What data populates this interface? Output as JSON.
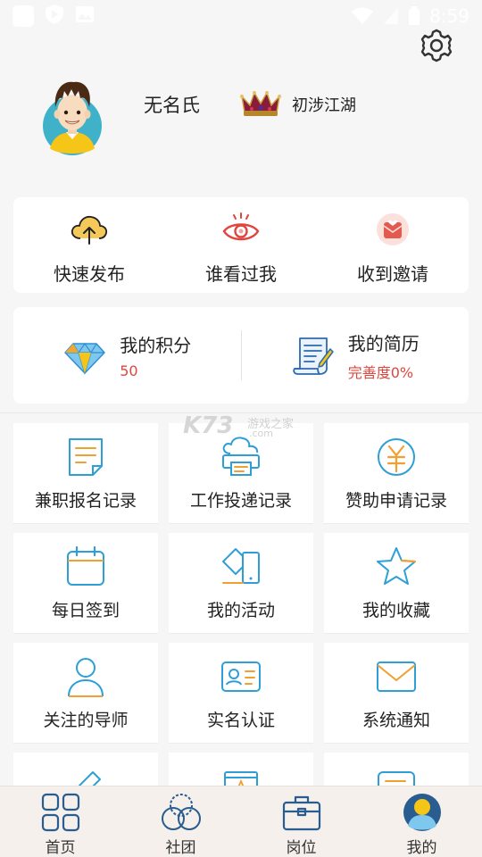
{
  "status_bar": {
    "time": "8:59"
  },
  "profile": {
    "name": "无名氏",
    "rank": "初涉江湖"
  },
  "actions": [
    {
      "label": "快速发布",
      "icon": "cloud-upload-icon"
    },
    {
      "label": "谁看过我",
      "icon": "eye-icon"
    },
    {
      "label": "收到邀请",
      "icon": "invitation-icon"
    }
  ],
  "stats": {
    "points": {
      "title": "我的积分",
      "value": "50",
      "icon": "diamond-icon"
    },
    "resume": {
      "title": "我的简历",
      "value": "完善度0%",
      "icon": "resume-icon"
    }
  },
  "grid": [
    {
      "label": "兼职报名记录",
      "icon": "document-icon"
    },
    {
      "label": "工作投递记录",
      "icon": "printer-icon"
    },
    {
      "label": "赞助申请记录",
      "icon": "yuan-icon"
    },
    {
      "label": "每日签到",
      "icon": "calendar-icon"
    },
    {
      "label": "我的活动",
      "icon": "phone-tablet-icon"
    },
    {
      "label": "我的收藏",
      "icon": "star-icon"
    },
    {
      "label": "关注的导师",
      "icon": "person-icon"
    },
    {
      "label": "实名认证",
      "icon": "id-card-icon"
    },
    {
      "label": "系统通知",
      "icon": "envelope-icon"
    },
    {
      "label": "",
      "icon": "pencil-icon"
    },
    {
      "label": "",
      "icon": "badge-icon"
    },
    {
      "label": "",
      "icon": "message-icon"
    }
  ],
  "watermark": {
    "big": "K73",
    "line1": "游戏之家",
    "line2": ".com"
  },
  "nav": [
    {
      "label": "首页",
      "icon": "home-grid-icon"
    },
    {
      "label": "社团",
      "icon": "community-icon"
    },
    {
      "label": "岗位",
      "icon": "briefcase-icon"
    },
    {
      "label": "我的",
      "icon": "user-avatar-icon",
      "active": true
    }
  ],
  "colors": {
    "accent": "#2e9fd6",
    "orange": "#f0a030",
    "red": "#e0463e",
    "nav_bg": "#f5f0ec"
  }
}
